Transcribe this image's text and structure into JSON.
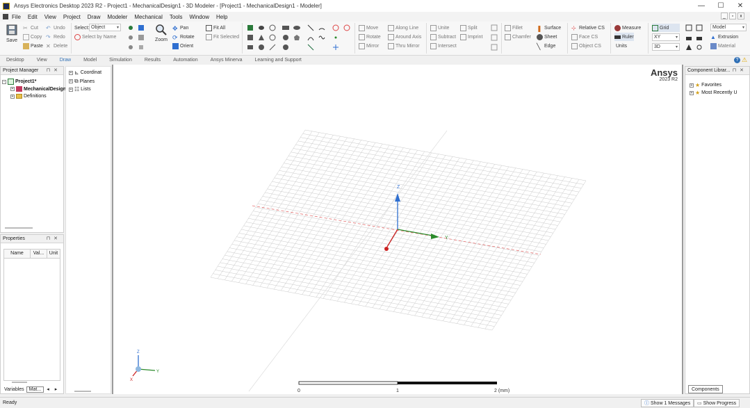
{
  "window": {
    "title": "Ansys Electronics Desktop 2023 R2 - Project1 - MechanicalDesign1 - 3D Modeler - [Project1 - MechanicalDesign1 - Modeler]",
    "controls": [
      "—",
      "☐",
      "✕"
    ]
  },
  "menu": {
    "items": [
      "File",
      "Edit",
      "View",
      "Project",
      "Draw",
      "Modeler",
      "Mechanical",
      "Tools",
      "Window",
      "Help"
    ],
    "mdi_controls": [
      "_",
      "▫",
      "x"
    ]
  },
  "ribbon": {
    "save": "Save",
    "cut": "Cut",
    "copy": "Copy",
    "paste": "Paste",
    "undo": "Undo",
    "redo": "Redo",
    "delete": "Delete",
    "select_label": "Select:",
    "select_value": "Object",
    "select_by_name": "Select by Name",
    "zoom": "Zoom",
    "pan": "Pan",
    "rotate": "Rotate",
    "orient": "Orient",
    "fit_all": "Fit All",
    "fit_selected": "Fit Selected",
    "move": "Move",
    "rotate2": "Rotate",
    "mirror": "Mirror",
    "along_line": "Along Line",
    "around_axis": "Around Axis",
    "thru_mirror": "Thru Mirror",
    "unite": "Unite",
    "subtract": "Subtract",
    "intersect": "Intersect",
    "split": "Split",
    "imprint": "Imprint",
    "fillet": "Fillet",
    "chamfer": "Chamfer",
    "surface": "Surface",
    "sheet": "Sheet",
    "edge": "Edge",
    "relative_cs": "Relative CS",
    "face_cs": "Face CS",
    "object_cs": "Object CS",
    "measure": "Measure",
    "ruler": "Ruler",
    "units": "Units",
    "grid": "Grid",
    "plane": "XY",
    "dim": "3D",
    "model": "Model",
    "extrusion": "Extrusion",
    "material": "Material"
  },
  "tabs": [
    "Desktop",
    "View",
    "Draw",
    "Model",
    "Simulation",
    "Results",
    "Automation",
    "Ansys Minerva",
    "Learning and Support"
  ],
  "active_tab": "Draw",
  "project_manager": {
    "title": "Project Manager",
    "project": "Project1*",
    "design": "MechanicalDesign",
    "definitions": "Definitions"
  },
  "properties": {
    "title": "Properties",
    "columns": [
      "Name",
      "Val...",
      "Unit"
    ]
  },
  "bottom_left_tabs": [
    "Variables",
    "Mat..."
  ],
  "model_tree": {
    "items": [
      "Coordinat",
      "Planes",
      "Lists"
    ]
  },
  "viewport": {
    "brand": "Ansys",
    "version": "2023 R2",
    "axis_x": "X",
    "axis_y": "Y",
    "axis_z": "Z",
    "scale_labels": [
      "0",
      "1",
      "2 (mm)"
    ],
    "colors": {
      "x_axis": "#cc2222",
      "y_axis": "#2a8a2a",
      "z_axis": "#2f6fd0",
      "grid": "#c8c8c8"
    }
  },
  "component_library": {
    "title": "Component Librar...",
    "items": [
      "Favorites",
      "Most Recently U"
    ],
    "tab": "Components"
  },
  "status": {
    "text": "Ready",
    "show_messages": "Show 1 Messages",
    "show_progress": "Show Progress"
  }
}
